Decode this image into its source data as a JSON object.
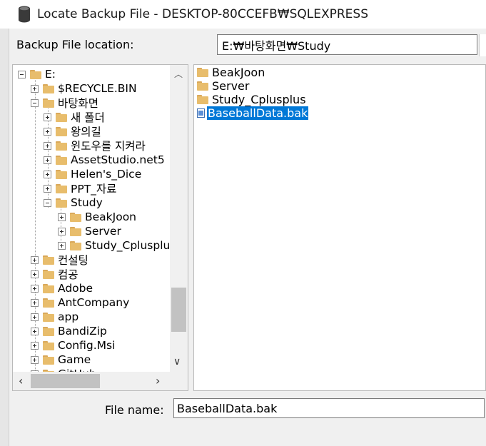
{
  "window": {
    "title": "Locate Backup File - DESKTOP-80CCEFB₩SQLEXPRESS",
    "icon": "database-icon"
  },
  "location": {
    "label": "Backup File location:",
    "value": "E:₩바탕화면₩Study"
  },
  "tree": [
    {
      "label": "E:",
      "expander": "minus"
    },
    {
      "label": "$RECYCLE.BIN",
      "expander": "plus"
    },
    {
      "label": "바탕화면",
      "expander": "minus"
    },
    {
      "label": "새 폴더",
      "expander": "plus"
    },
    {
      "label": "왕의길",
      "expander": "plus"
    },
    {
      "label": "윈도우를 지켜라",
      "expander": "plus"
    },
    {
      "label": "AssetStudio.net5",
      "expander": "plus"
    },
    {
      "label": "Helen's_Dice",
      "expander": "plus"
    },
    {
      "label": "PPT_자료",
      "expander": "plus"
    },
    {
      "label": "Study",
      "expander": "minus"
    },
    {
      "label": "BeakJoon",
      "expander": "plus"
    },
    {
      "label": "Server",
      "expander": "plus"
    },
    {
      "label": "Study_Cplusplus",
      "expander": "plus"
    },
    {
      "label": "컨설팅",
      "expander": "plus"
    },
    {
      "label": "컴공",
      "expander": "plus"
    },
    {
      "label": "Adobe",
      "expander": "plus"
    },
    {
      "label": "AntCompany",
      "expander": "plus"
    },
    {
      "label": "app",
      "expander": "plus"
    },
    {
      "label": "BandiZip",
      "expander": "plus"
    },
    {
      "label": "Config.Msi",
      "expander": "plus"
    },
    {
      "label": "Game",
      "expander": "plus"
    },
    {
      "label": "GitHub",
      "expander": "plus"
    }
  ],
  "files": [
    {
      "label": "BeakJoon",
      "type": "folder"
    },
    {
      "label": "Server",
      "type": "folder"
    },
    {
      "label": "Study_Cplusplus",
      "type": "folder"
    },
    {
      "label": "BaseballData.bak",
      "type": "file",
      "selected": true
    }
  ],
  "filename": {
    "label": "File name:",
    "value": "BaseballData.bak"
  },
  "colors": {
    "selection": "#0078d7",
    "folder": "#e8bd6c"
  }
}
